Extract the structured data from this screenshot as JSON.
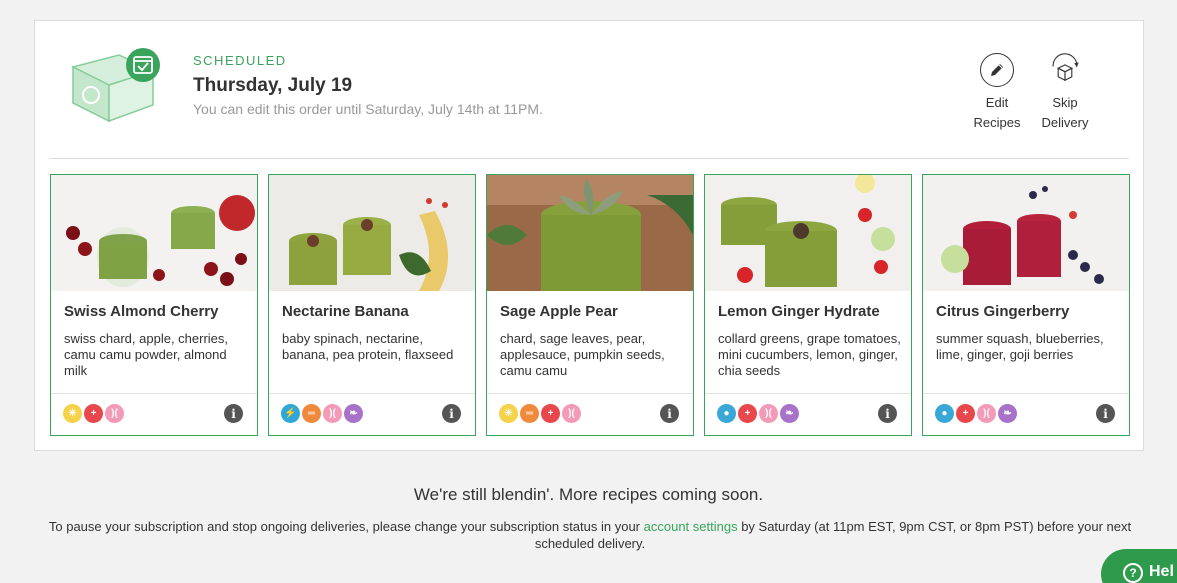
{
  "order": {
    "status": "SCHEDULED",
    "date": "Thursday, July 19",
    "edit_note": "You can edit this order until Saturday, July 14th at 11PM."
  },
  "actions": {
    "edit_line1": "Edit",
    "edit_line2": "Recipes",
    "skip_line1": "Skip",
    "skip_line2": "Delivery"
  },
  "recipes": [
    {
      "name": "Swiss Almond Cherry",
      "ingredients": "swiss chard, apple, cherries, camu camu powder, almond milk",
      "badges": [
        "sun-icon",
        "health-cross-icon",
        "beauty-icon"
      ]
    },
    {
      "name": "Nectarine Banana",
      "ingredients": "baby spinach, nectarine, banana, pea protein, flaxseed",
      "badges": [
        "energy-bolt-icon",
        "dumbbell-icon",
        "beauty-icon",
        "leaf-icon"
      ]
    },
    {
      "name": "Sage Apple Pear",
      "ingredients": "chard, sage leaves, pear, applesauce, pumpkin seeds, camu camu",
      "badges": [
        "sun-icon",
        "dumbbell-icon",
        "health-cross-icon",
        "beauty-icon"
      ]
    },
    {
      "name": "Lemon Ginger Hydrate",
      "ingredients": "collard greens, grape tomatoes, mini cucumbers, lemon, ginger, chia seeds",
      "badges": [
        "water-drop-icon",
        "health-cross-icon",
        "beauty-icon",
        "leaf-icon"
      ]
    },
    {
      "name": "Citrus Gingerberry",
      "ingredients": "summer squash, blueberries, lime, ginger, goji berries",
      "badges": [
        "water-drop-icon",
        "health-cross-icon",
        "beauty-icon",
        "leaf-icon"
      ]
    }
  ],
  "footer": {
    "coming_soon": "We're still blendin'. More recipes coming soon.",
    "pause_before": "To pause your subscription and stop ongoing deliveries, please change your subscription status in your ",
    "pause_link": "account settings",
    "pause_after": " by Saturday (at 11pm EST, 9pm CST, or 8pm PST) before your next scheduled delivery."
  },
  "help": {
    "label": "Hel"
  },
  "colors": {
    "accent": "#3aa45c",
    "sun": "#f5d24a",
    "health": "#e8474b",
    "beauty": "#f29ab7",
    "energy": "#2fa8d8",
    "fitness": "#ef8a3c",
    "leaf": "#a872c8",
    "water": "#39a8d6"
  }
}
